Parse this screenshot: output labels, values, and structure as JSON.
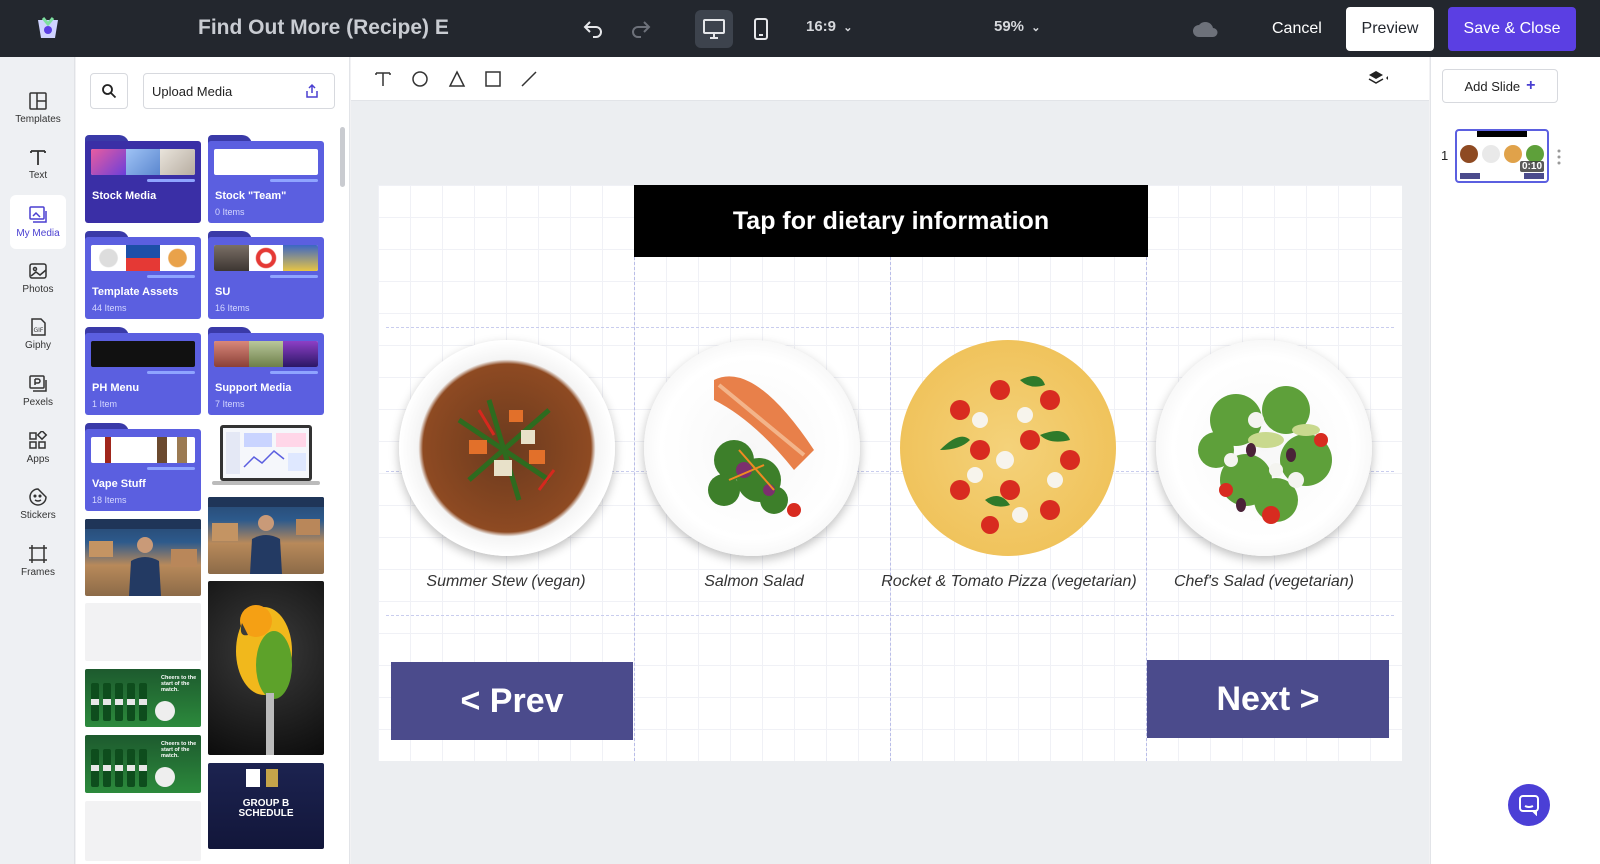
{
  "header": {
    "title": "Find Out More (Recipe) E",
    "aspect_ratio": "16:9",
    "zoom": "59%",
    "cancel_label": "Cancel",
    "preview_label": "Preview",
    "save_label": "Save & Close"
  },
  "leftnav": {
    "items": [
      {
        "label": "Templates",
        "icon": "templates-icon"
      },
      {
        "label": "Text",
        "icon": "text-icon"
      },
      {
        "label": "My Media",
        "icon": "my-media-icon"
      },
      {
        "label": "Photos",
        "icon": "photos-icon"
      },
      {
        "label": "Giphy",
        "icon": "gif-icon"
      },
      {
        "label": "Pexels",
        "icon": "pexels-icon"
      },
      {
        "label": "Apps",
        "icon": "apps-icon"
      },
      {
        "label": "Stickers",
        "icon": "stickers-icon"
      },
      {
        "label": "Frames",
        "icon": "frames-icon"
      }
    ],
    "active": "My Media"
  },
  "media": {
    "upload_label": "Upload Media",
    "folders": [
      {
        "name": "Stock Media",
        "count": ""
      },
      {
        "name": "Stock \"Team\"",
        "count": "0 Items"
      },
      {
        "name": "Template Assets",
        "count": "44 Items"
      },
      {
        "name": "SU",
        "count": "16 Items"
      },
      {
        "name": "PH Menu",
        "count": "1 Item"
      },
      {
        "name": "Support Media",
        "count": "7 Items"
      },
      {
        "name": "Vape Stuff",
        "count": "18 Items"
      }
    ],
    "thumb_text": {
      "cheers": "Cheers to the start of the match.",
      "schedule": "GROUP B SCHEDULE"
    }
  },
  "slide": {
    "banner": "Tap for dietary information",
    "dishes": [
      {
        "name": "Summer Stew (vegan)"
      },
      {
        "name": "Salmon Salad"
      },
      {
        "name": "Rocket & Tomato Pizza (vegetarian)"
      },
      {
        "name": "Chef's Salad (vegetarian)"
      }
    ],
    "prev_label": "< Prev",
    "next_label": "Next >"
  },
  "slides_panel": {
    "add_slide_label": "Add Slide",
    "slide_number": "1",
    "duration": "0:10"
  },
  "colors": {
    "accent": "#5b3fe3",
    "topbar": "#23272e",
    "nav_button": "#4b4b8c",
    "folder": "#5b5fe0"
  }
}
